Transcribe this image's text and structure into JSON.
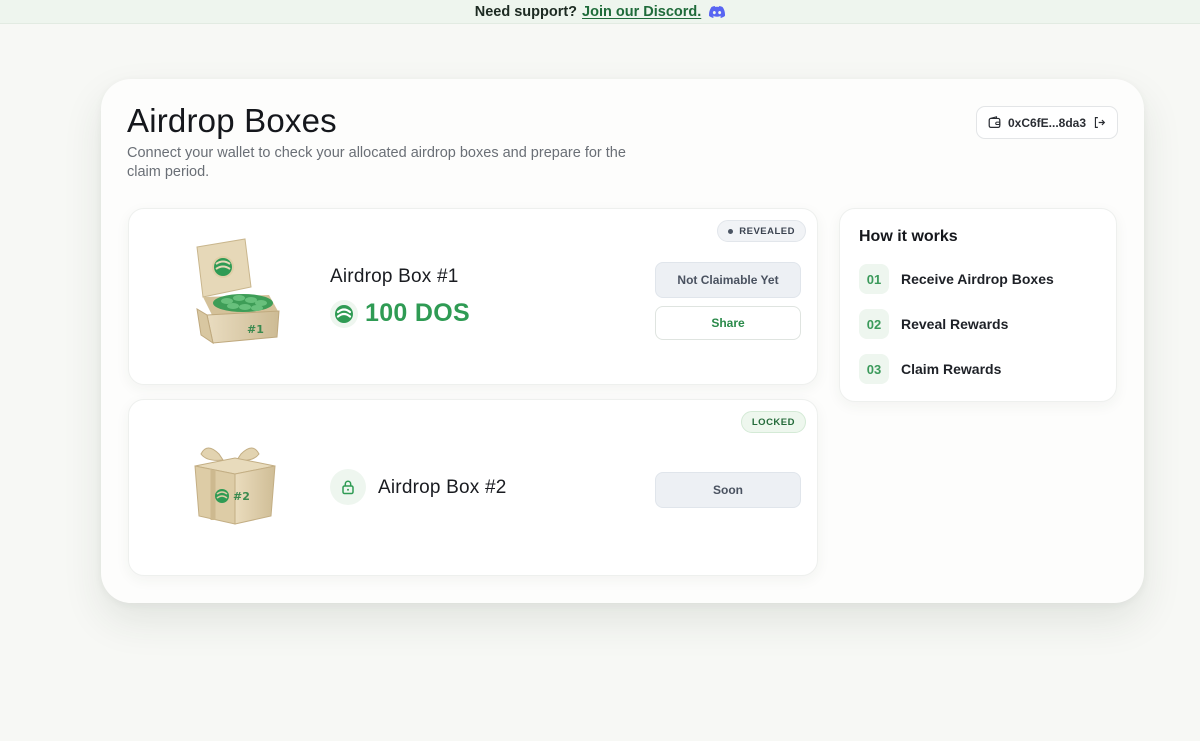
{
  "banner": {
    "text": "Need support?",
    "link_label": "Join our Discord."
  },
  "page": {
    "title": "Airdrop Boxes",
    "subtitle": "Connect your wallet to check your allocated airdrop boxes and prepare for the claim period."
  },
  "wallet": {
    "address": "0xC6fE...8da3"
  },
  "boxes": [
    {
      "name": "Airdrop Box #1",
      "status": "REVEALED",
      "amount": "100 DOS",
      "art_label": "#1",
      "primary_button": "Not Claimable Yet",
      "secondary_button": "Share"
    },
    {
      "name": "Airdrop Box #2",
      "status": "LOCKED",
      "art_label": "#2",
      "primary_button": "Soon"
    }
  ],
  "how_it_works": {
    "title": "How it works",
    "steps": [
      {
        "num": "01",
        "label": "Receive Airdrop Boxes"
      },
      {
        "num": "02",
        "label": "Reveal Rewards"
      },
      {
        "num": "03",
        "label": "Claim Rewards"
      }
    ]
  },
  "colors": {
    "accent": "#2f9b54",
    "banner_bg": "#eef5ee",
    "discord": "#5865f2"
  },
  "icons": {
    "discord": "discord-icon",
    "wallet": "wallet-icon",
    "logout": "logout-icon",
    "token": "dos-token-icon",
    "lock": "lock-icon"
  }
}
